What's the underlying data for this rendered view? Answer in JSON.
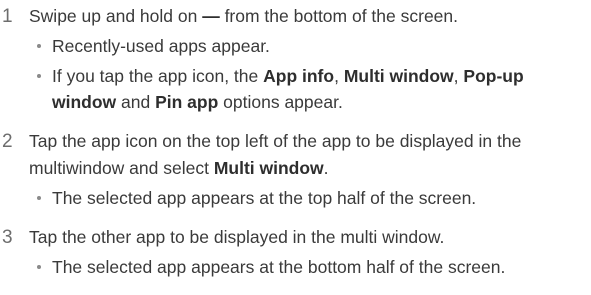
{
  "steps": [
    {
      "number": "1",
      "text_a": "Swipe up and hold on ",
      "dash": "—",
      "text_b": " from the bottom of the screen.",
      "bullets": [
        {
          "text": "Recently-used apps appear."
        },
        {
          "p1": "If you tap the app icon, the ",
          "b1": "App info",
          "p2": ", ",
          "b2": "Multi window",
          "p3": ", ",
          "b3": "Pop-up",
          "b4": "window",
          "p4": " and ",
          "b5": "Pin app",
          "p5": " options appear."
        }
      ]
    },
    {
      "number": "2",
      "line1": "Tap the app icon on the top left of the app to be displayed in the",
      "line2a": "multiwindow and select ",
      "line2b": "Multi window",
      "line2c": ".",
      "bullets": [
        {
          "text": "The selected app appears at the top half of the screen."
        }
      ]
    },
    {
      "number": "3",
      "text": "Tap the other app to be displayed in the multi window.",
      "bullets": [
        {
          "text": "The selected app appears at the bottom half of the screen."
        }
      ]
    }
  ]
}
